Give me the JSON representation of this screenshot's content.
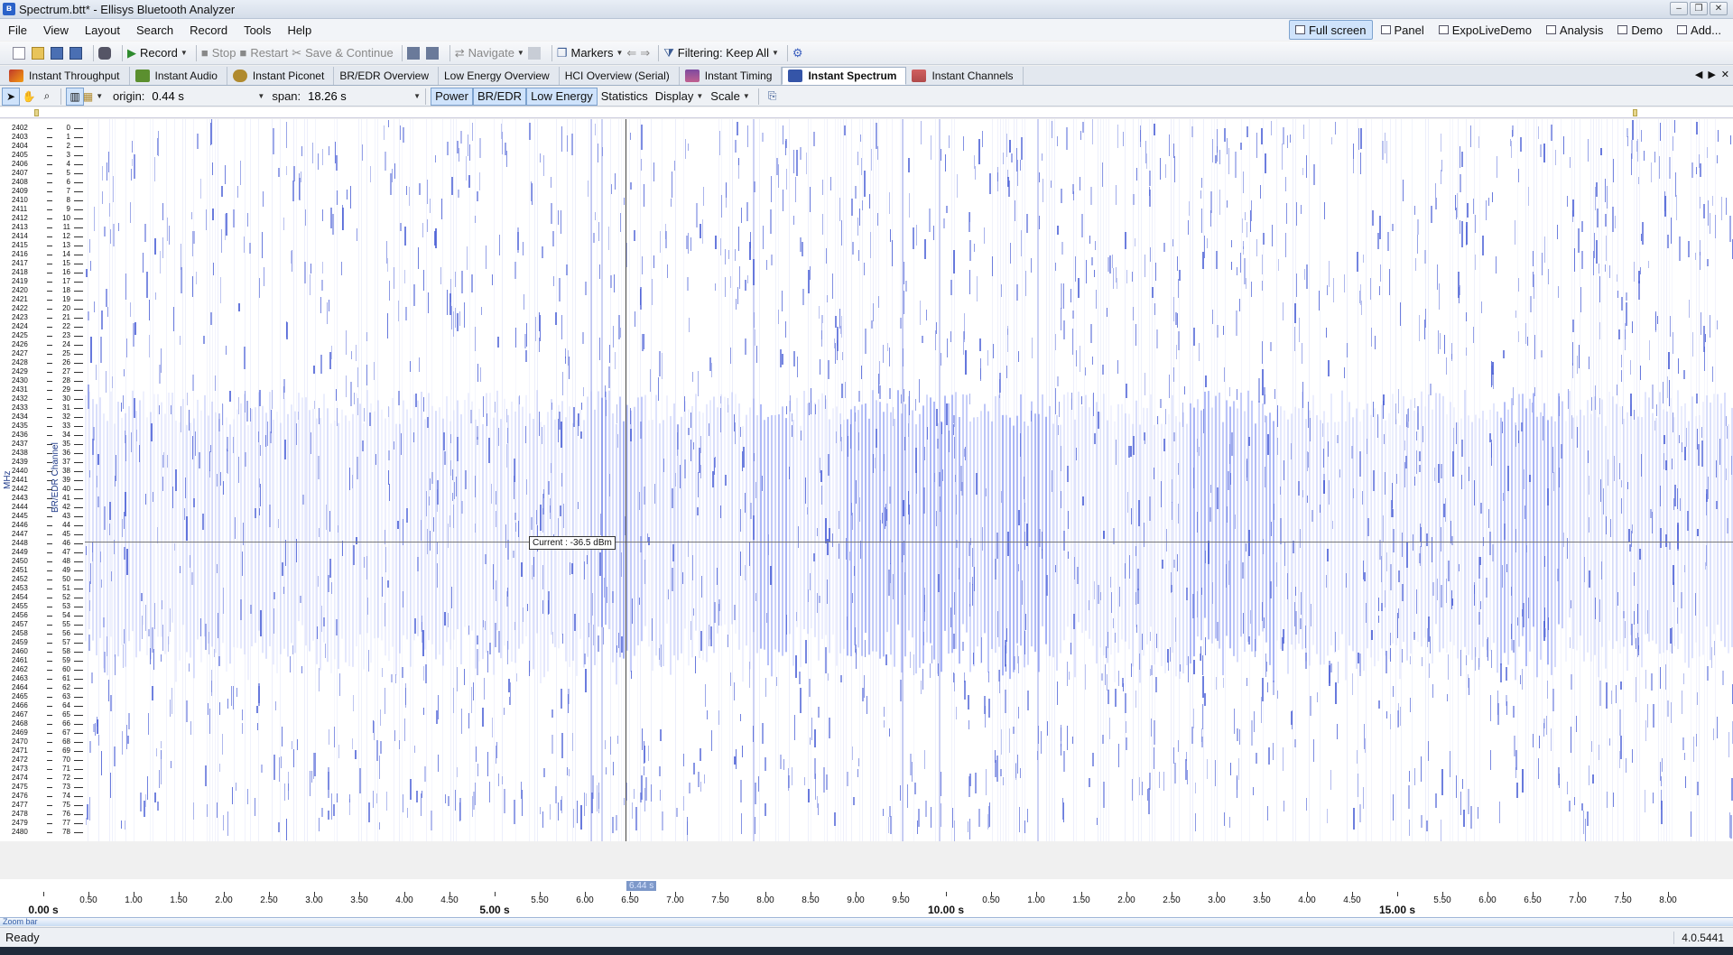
{
  "window": {
    "title": "Spectrum.btt* - Ellisys Bluetooth Analyzer",
    "app_icon": "bluetooth-app-icon"
  },
  "menu": {
    "items": [
      "File",
      "View",
      "Layout",
      "Search",
      "Record",
      "Tools",
      "Help"
    ]
  },
  "perspectives": [
    {
      "label": "Full screen",
      "active": true
    },
    {
      "label": "Panel",
      "active": false
    },
    {
      "label": "ExpoLiveDemo",
      "active": false
    },
    {
      "label": "Analysis",
      "active": false
    },
    {
      "label": "Demo",
      "active": false
    },
    {
      "label": "Add...",
      "active": false
    }
  ],
  "toolbar": {
    "record": "Record",
    "stop": "Stop",
    "restart": "Restart",
    "save_continue": "Save & Continue",
    "navigate": "Navigate",
    "markers": "Markers",
    "filtering": "Filtering: Keep All"
  },
  "tabs": [
    {
      "label": "Instant Throughput",
      "color": "#c0392b"
    },
    {
      "label": "Instant Audio",
      "color": "#5b8f2f"
    },
    {
      "label": "Instant Piconet",
      "color": "#b08a2e"
    },
    {
      "label": "BR/EDR Overview",
      "color": ""
    },
    {
      "label": "Low Energy Overview",
      "color": ""
    },
    {
      "label": "HCI Overview (Serial)",
      "color": ""
    },
    {
      "label": "Instant Timing",
      "color": "#7d4aa0"
    },
    {
      "label": "Instant Spectrum",
      "color": "#3555a8",
      "active": true
    },
    {
      "label": "Instant Channels",
      "color": "#b04a4a"
    }
  ],
  "spectrum_toolbar": {
    "origin_label": "origin:",
    "origin_value": "0.44 s",
    "span_label": "span:",
    "span_value": "18.26 s",
    "power": "Power",
    "bredr": "BR/EDR",
    "low_energy": "Low Energy",
    "statistics": "Statistics",
    "display": "Display",
    "scale": "Scale"
  },
  "spectrogram": {
    "y_title_mhz": "MHz",
    "y_title_channel": "BR/EDR Channel",
    "mhz_start": 2402,
    "mhz_end": 2480,
    "channel_start": 0,
    "channel_end": 78,
    "cursor_tooltip": "Current : -36.5 dBm",
    "cursor_time": "6.44 s",
    "trace_color": "#4a5fd6",
    "le_band_color": "#6b7ff0"
  },
  "x_axis": {
    "minor": [
      "0.50",
      "1.00",
      "1.50",
      "2.00",
      "2.50",
      "3.00",
      "3.50",
      "4.00",
      "4.50",
      "5.50",
      "6.00",
      "6.50",
      "7.00",
      "7.50",
      "8.00",
      "8.50",
      "9.00",
      "9.50",
      "0.50",
      "1.00",
      "1.50",
      "2.00",
      "2.50",
      "3.00",
      "3.50",
      "4.00",
      "4.50",
      "5.50",
      "6.00",
      "6.50",
      "7.00",
      "7.50",
      "8.00",
      "8.50"
    ],
    "major": [
      "0.00 s",
      "5.00 s",
      "10.00 s",
      "15.00 s"
    ]
  },
  "zoom_bar": "Zoom bar",
  "status": {
    "text": "Ready",
    "version": "4.0.5441"
  }
}
